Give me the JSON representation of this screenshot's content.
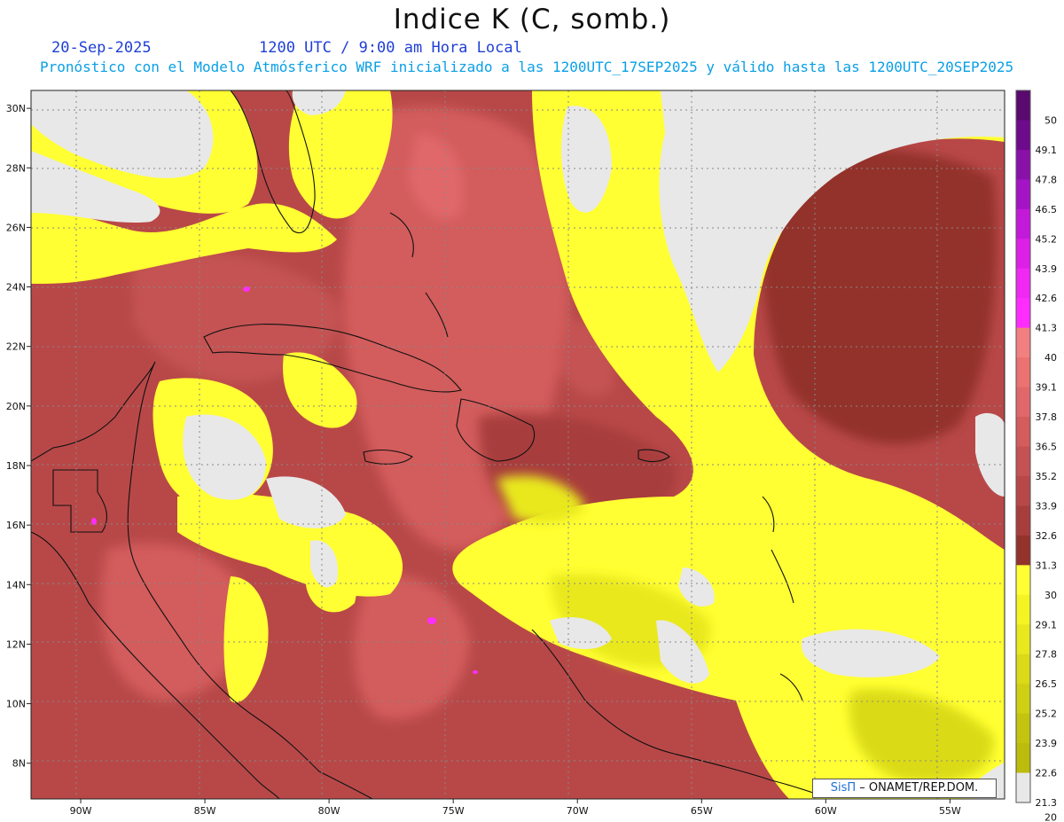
{
  "header": {
    "title": "Indice K (C, somb.)",
    "date": "20-Sep-2025",
    "time_text": "1200 UTC / 9:00 am Hora Local",
    "forecast_text": "Pronóstico con el Modelo Atmósferico WRF inicializado a las 1200UTC_17SEP2025 y válido hasta las  1200UTC_20SEP2025"
  },
  "map": {
    "lon_labels": [
      "90W",
      "85W",
      "80W",
      "75W",
      "70W",
      "65W",
      "60W",
      "55W"
    ],
    "lat_labels": [
      "30N",
      "28N",
      "26N",
      "24N",
      "22N",
      "20N",
      "18N",
      "16N",
      "14N",
      "12N",
      "10N",
      "8N"
    ],
    "lon_range": [
      -92,
      -52.8
    ],
    "lat_range": [
      6.8,
      30.6
    ]
  },
  "legend": {
    "labels": [
      "50",
      "49.1",
      "47.8",
      "46.5",
      "45.2",
      "43.9",
      "42.6",
      "41.3",
      "40",
      "39.1",
      "37.8",
      "36.5",
      "35.2",
      "33.9",
      "32.6",
      "31.3",
      "30",
      "29.1",
      "27.8",
      "26.5",
      "25.2",
      "23.9",
      "22.6",
      "21.3",
      "20"
    ],
    "colors": [
      "#5a0a6e",
      "#6e0a8c",
      "#8a10aa",
      "#a514c4",
      "#c21ad8",
      "#dd20e8",
      "#ef28f2",
      "#ff2cff",
      "#f28080",
      "#ea7270",
      "#e0676a",
      "#d35c5c",
      "#c55252",
      "#b84848",
      "#a83e3c",
      "#93332c",
      "#ffff33",
      "#f4f424",
      "#e8e81e",
      "#dada18",
      "#cfcf14",
      "#c4c410",
      "#bcbc0c",
      "#e8e8e8"
    ]
  },
  "badge": {
    "brand": "SisΠ",
    "credit": " – ONAMET/REP.DOM."
  }
}
